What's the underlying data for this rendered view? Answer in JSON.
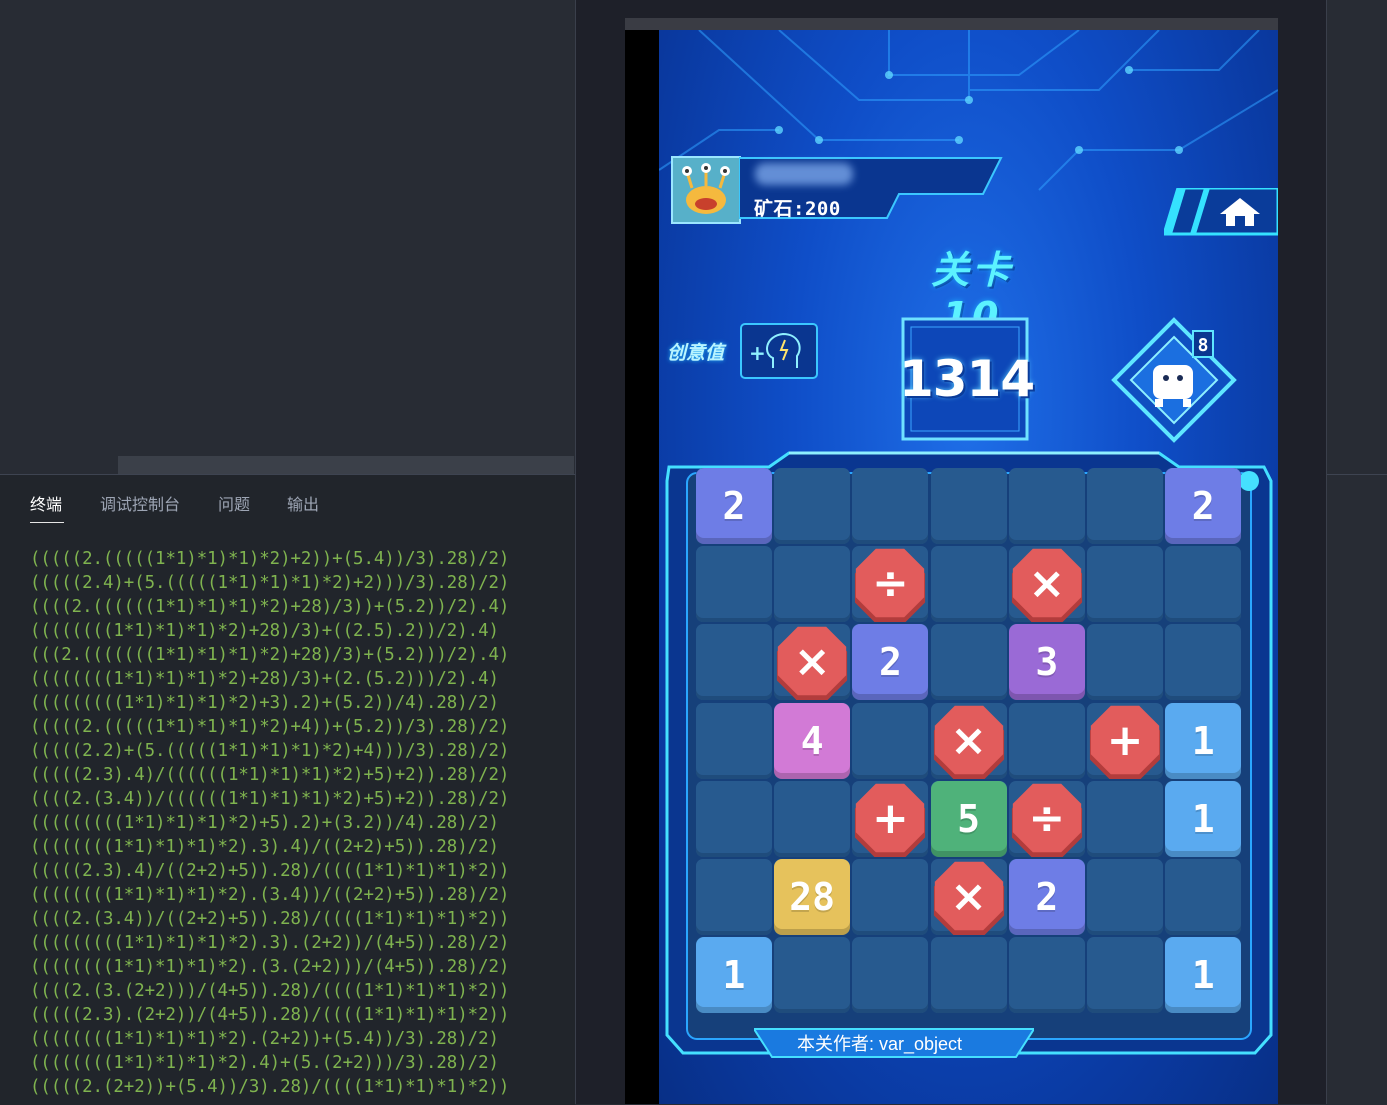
{
  "panel": {
    "tabs": [
      {
        "label": "终端",
        "active": true
      },
      {
        "label": "调试控制台",
        "active": false
      },
      {
        "label": "问题",
        "active": false
      },
      {
        "label": "输出",
        "active": false
      }
    ],
    "terminal_lines": [
      "(((((2.(((((1*1)*1)*1)*2)+2))+(5.4))/3).28)/2)",
      "(((((2.4)+(5.(((((1*1)*1)*1)*2)+2)))/3).28)/2)",
      "((((2.((((((1*1)*1)*1)*2)+28)/3))+(5.2))/2).4)",
      "((((((((1*1)*1)*1)*2)+28)/3)+((2.5).2))/2).4)",
      "(((2.(((((((1*1)*1)*1)*2)+28)/3)+(5.2)))/2).4)",
      "((((((((1*1)*1)*1)*2)+28)/3)+(2.(5.2)))/2).4)",
      "(((((((((1*1)*1)*1)*2)+3).2)+(5.2))/4).28)/2)",
      "(((((2.(((((1*1)*1)*1)*2)+4))+(5.2))/3).28)/2)",
      "(((((2.2)+(5.(((((1*1)*1)*1)*2)+4)))/3).28)/2)",
      "(((((2.3).4)/((((((1*1)*1)*1)*2)+5)+2)).28)/2)",
      "((((2.(3.4))/((((((1*1)*1)*1)*2)+5)+2)).28)/2)",
      "(((((((((1*1)*1)*1)*2)+5).2)+(3.2))/4).28)/2)",
      "((((((((1*1)*1)*1)*2).3).4)/((2+2)+5)).28)/2)",
      "(((((2.3).4)/((2+2)+5)).28)/((((1*1)*1)*1)*2))",
      "((((((((1*1)*1)*1)*2).(3.4))/((2+2)+5)).28)/2)",
      "((((2.(3.4))/((2+2)+5)).28)/((((1*1)*1)*1)*2))",
      "(((((((((1*1)*1)*1)*2).3).(2+2))/(4+5)).28)/2)",
      "((((((((1*1)*1)*1)*2).(3.(2+2)))/(4+5)).28)/2)",
      "((((2.(3.(2+2)))/(4+5)).28)/((((1*1)*1)*1)*2))",
      "(((((2.3).(2+2))/(4+5)).28)/((((1*1)*1)*1)*2))",
      "((((((((1*1)*1)*1)*2).(2+2))+(5.4))/3).28)/2)",
      "((((((((1*1)*1)*1)*2).4)+(5.(2+2)))/3).28)/2)",
      "(((((2.(2+2))+(5.4))/3).28)/((((1*1)*1)*1)*2))"
    ]
  },
  "game": {
    "ore_label": "矿石:200",
    "level_title": "关卡10",
    "creative_label": "创意值",
    "creative_plus": "+",
    "score": "1314",
    "robot_badge": "8",
    "author": "本关作者: var_object",
    "colors": {
      "tile_blue": "#5aaaf0",
      "tile_purple": "#6e7de6",
      "tile_violet": "#9a6ad6",
      "tile_pink": "#d27ad6",
      "tile_green": "#4fb27a",
      "tile_yellow": "#e6c25c",
      "op_red": "#e25c5c"
    },
    "board": {
      "rows": 7,
      "cols": 7,
      "tiles": [
        {
          "row": 0,
          "col": 0,
          "kind": "number",
          "label": "2",
          "color": "#6e7de6"
        },
        {
          "row": 0,
          "col": 6,
          "kind": "number",
          "label": "2",
          "color": "#6e7de6"
        },
        {
          "row": 1,
          "col": 2,
          "kind": "operator",
          "label": "÷",
          "color": "#e25c5c"
        },
        {
          "row": 1,
          "col": 4,
          "kind": "operator",
          "label": "×",
          "color": "#e25c5c"
        },
        {
          "row": 2,
          "col": 1,
          "kind": "operator",
          "label": "×",
          "color": "#e25c5c"
        },
        {
          "row": 2,
          "col": 2,
          "kind": "number",
          "label": "2",
          "color": "#6e7de6"
        },
        {
          "row": 2,
          "col": 4,
          "kind": "number",
          "label": "3",
          "color": "#9a6ad6"
        },
        {
          "row": 3,
          "col": 1,
          "kind": "number",
          "label": "4",
          "color": "#d27ad6"
        },
        {
          "row": 3,
          "col": 3,
          "kind": "operator",
          "label": "×",
          "color": "#e25c5c"
        },
        {
          "row": 3,
          "col": 5,
          "kind": "operator",
          "label": "+",
          "color": "#e25c5c"
        },
        {
          "row": 3,
          "col": 6,
          "kind": "number",
          "label": "1",
          "color": "#5aaaf0"
        },
        {
          "row": 4,
          "col": 2,
          "kind": "operator",
          "label": "+",
          "color": "#e25c5c"
        },
        {
          "row": 4,
          "col": 3,
          "kind": "number",
          "label": "5",
          "color": "#4fb27a"
        },
        {
          "row": 4,
          "col": 4,
          "kind": "operator",
          "label": "÷",
          "color": "#e25c5c"
        },
        {
          "row": 4,
          "col": 6,
          "kind": "number",
          "label": "1",
          "color": "#5aaaf0"
        },
        {
          "row": 5,
          "col": 1,
          "kind": "number",
          "label": "28",
          "color": "#e6c25c"
        },
        {
          "row": 5,
          "col": 3,
          "kind": "operator",
          "label": "×",
          "color": "#e25c5c"
        },
        {
          "row": 5,
          "col": 4,
          "kind": "number",
          "label": "2",
          "color": "#6e7de6"
        },
        {
          "row": 6,
          "col": 0,
          "kind": "number",
          "label": "1",
          "color": "#5aaaf0"
        },
        {
          "row": 6,
          "col": 6,
          "kind": "number",
          "label": "1",
          "color": "#5aaaf0"
        }
      ]
    }
  }
}
